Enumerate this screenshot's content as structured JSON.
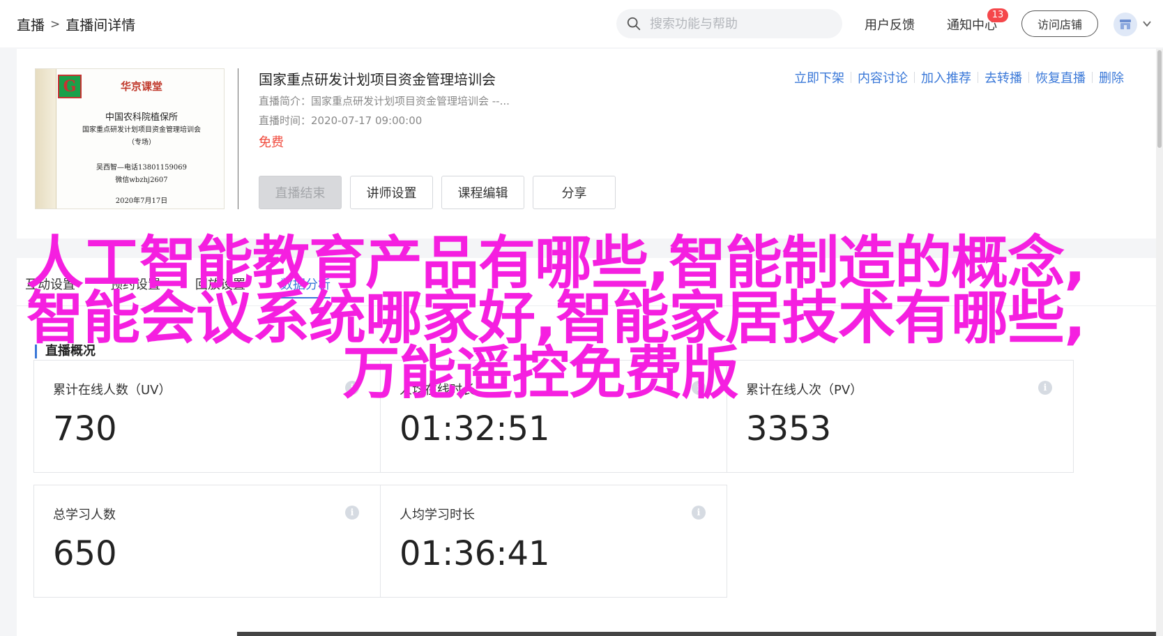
{
  "header": {
    "breadcrumb": [
      "直播",
      "直播间详情"
    ],
    "breadcrumb_sep": ">",
    "search_placeholder": "搜索功能与帮助",
    "feedback": "用户反馈",
    "notifications": "通知中心",
    "notification_count": "13",
    "visit_store": "访问店铺"
  },
  "course": {
    "cover": {
      "brand": "华京课堂",
      "org": "中国农科院植保所",
      "course": "国家重点研发计划项目资金管理培训会",
      "special": "（专场）",
      "contact1": "吴西智—电话13801159069",
      "contact2": "微信wbzhj2607",
      "date": "2020年7月17日"
    },
    "title": "国家重点研发计划项目资金管理培训会",
    "intro": "直播简介：国家重点研发计划项目资金管理培训会 --...",
    "time": "直播时间：2020-07-17 09:00:00",
    "price": "免费",
    "actions": [
      "直播结束",
      "讲师设置",
      "课程编辑",
      "分享"
    ],
    "links": [
      "立即下架",
      "内容讨论",
      "加入推荐",
      "去转播",
      "恢复直播",
      "删除"
    ]
  },
  "stats": {
    "tabs": [
      "互动设置",
      "预约设置",
      "回放设置",
      "数据分析"
    ],
    "active_tab": 3,
    "section_title": "直播概况",
    "cards": [
      {
        "label": "累计在线人数（UV）",
        "value": "730"
      },
      {
        "label": "人均在线时长",
        "value": "01:32:51"
      },
      {
        "label": "累计在线人次（PV）",
        "value": "3353"
      },
      {
        "label": "总学习人数",
        "value": "650"
      },
      {
        "label": "人均学习时长",
        "value": "01:36:41"
      }
    ]
  },
  "overlay": {
    "line1": "人工智能教育产品有哪些,智能制造的概念,",
    "line2": "智能会议系统哪家好,智能家居技术有哪些,",
    "line3": "万能遥控免费版"
  },
  "colors": {
    "accent": "#3a78d8",
    "price": "#f04a3c",
    "badge": "#f5474b",
    "overlay": "#f51fe0"
  }
}
